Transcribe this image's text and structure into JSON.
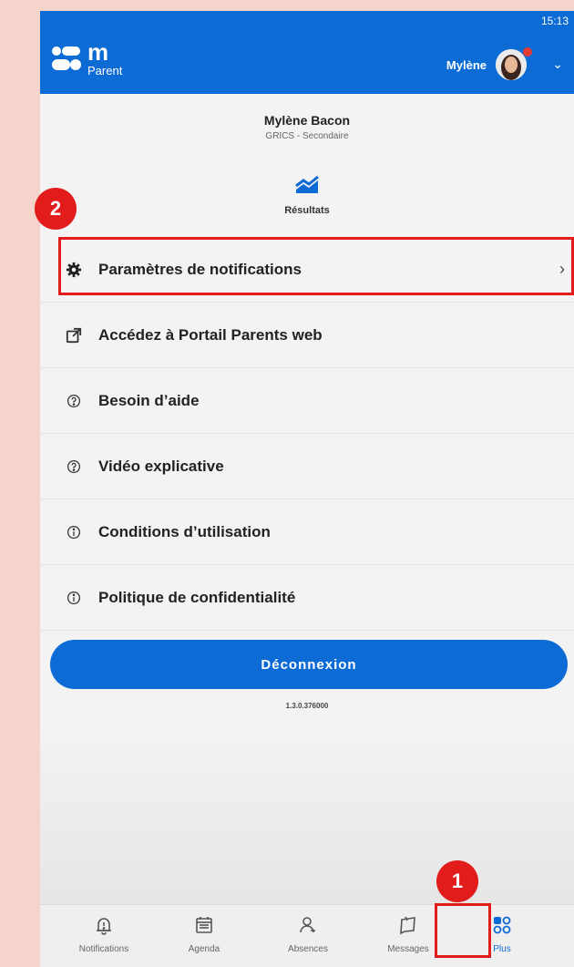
{
  "status": {
    "time": "15:13"
  },
  "header": {
    "logo_m": "m",
    "logo_sub": "Parent",
    "user_name": "Mylène"
  },
  "profile": {
    "name": "Mylène Bacon",
    "school": "GRICS - Secondaire"
  },
  "results": {
    "label": "Résultats",
    "icon": "chart-trend-icon"
  },
  "menu": {
    "items": [
      {
        "label": "Paramètres de notifications",
        "icon": "gear-icon",
        "has_arrow": true
      },
      {
        "label": "Accédez à Portail Parents web",
        "icon": "external-link-icon"
      },
      {
        "label": "Besoin d’aide",
        "icon": "help-circle-icon"
      },
      {
        "label": "Vidéo explicative",
        "icon": "help-circle-icon"
      },
      {
        "label": "Conditions d’utilisation",
        "icon": "info-icon"
      },
      {
        "label": "Politique de confidentialité",
        "icon": "info-icon"
      }
    ]
  },
  "logout_label": "Déconnexion",
  "version": "1.3.0.376000",
  "tabbar": {
    "tabs": [
      {
        "label": "Notifications",
        "icon": "bell-alert-icon"
      },
      {
        "label": "Agenda",
        "icon": "calendar-icon"
      },
      {
        "label": "Absences",
        "icon": "person-icon"
      },
      {
        "label": "Messages",
        "icon": "message-icon"
      },
      {
        "label": "Plus",
        "icon": "more-apps-icon",
        "active": true
      }
    ]
  },
  "annotations": {
    "step1": "1",
    "step2": "2"
  },
  "colors": {
    "brand": "#0d6bd6",
    "annotation": "#e21b1b"
  }
}
